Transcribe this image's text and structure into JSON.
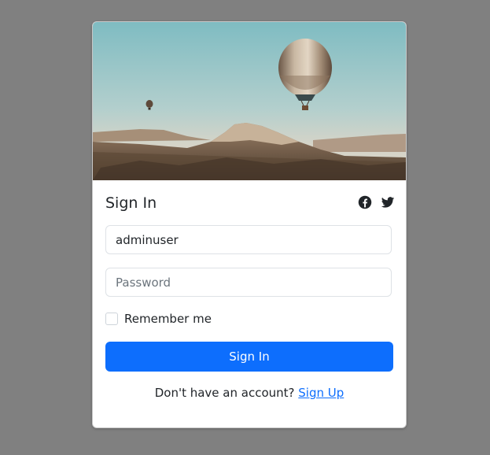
{
  "login": {
    "title": "Sign In",
    "username_value": "adminuser",
    "password_placeholder": "Password",
    "remember_label": "Remember me",
    "submit_label": "Sign In",
    "signup_prompt": "Don't have an account?",
    "signup_link": "Sign Up"
  },
  "social": {
    "icons": [
      "facebook-icon",
      "twitter-icon"
    ]
  },
  "colors": {
    "page_background": "#808080",
    "primary": "#0d6efd",
    "text": "#212529"
  }
}
